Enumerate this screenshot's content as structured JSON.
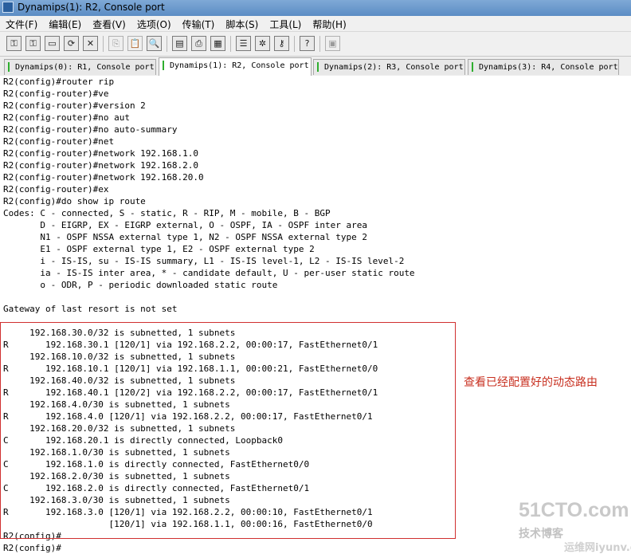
{
  "window": {
    "title": "Dynamips(1): R2, Console port"
  },
  "menu": [
    "文件(F)",
    "编辑(E)",
    "查看(V)",
    "选项(O)",
    "传输(T)",
    "脚本(S)",
    "工具(L)",
    "帮助(H)"
  ],
  "toolbar": {
    "icons": [
      "connect-icon",
      "quick-connect-icon",
      "connect-tab-icon",
      "reconnect-icon",
      "disconnect-icon",
      "copy-icon",
      "paste-icon",
      "find-icon",
      "print-setup-icon",
      "print-icon",
      "print-screen-icon",
      "session-options-icon",
      "global-options-icon",
      "keymap-icon",
      "help-icon",
      "sftp-icon"
    ],
    "glyphs": [
      "⚿",
      "⚿",
      "▭",
      "⟳",
      "✕",
      "⎘",
      "📋",
      "🔍",
      "▤",
      "⎙",
      "▦",
      "☰",
      "✲",
      "⚷",
      "?",
      "▣"
    ]
  },
  "tabs": [
    {
      "label": "Dynamips(0): R1, Console port",
      "active": false
    },
    {
      "label": "Dynamips(1): R2, Console port",
      "active": true
    },
    {
      "label": "Dynamips(2): R3, Console port",
      "active": false
    },
    {
      "label": "Dynamips(3): R4, Console port",
      "active": false
    }
  ],
  "terminal": {
    "lines": [
      "R2(config)#router rip",
      "R2(config-router)#ve",
      "R2(config-router)#version 2",
      "R2(config-router)#no aut",
      "R2(config-router)#no auto-summary",
      "R2(config-router)#net",
      "R2(config-router)#network 192.168.1.0",
      "R2(config-router)#network 192.168.2.0",
      "R2(config-router)#network 192.168.20.0",
      "R2(config-router)#ex",
      "R2(config)#do show ip route",
      "Codes: C - connected, S - static, R - RIP, M - mobile, B - BGP",
      "       D - EIGRP, EX - EIGRP external, O - OSPF, IA - OSPF inter area",
      "       N1 - OSPF NSSA external type 1, N2 - OSPF NSSA external type 2",
      "       E1 - OSPF external type 1, E2 - OSPF external type 2",
      "       i - IS-IS, su - IS-IS summary, L1 - IS-IS level-1, L2 - IS-IS level-2",
      "       ia - IS-IS inter area, * - candidate default, U - per-user static route",
      "       o - ODR, P - periodic downloaded static route",
      "",
      "Gateway of last resort is not set",
      "",
      "     192.168.30.0/32 is subnetted, 1 subnets",
      "R       192.168.30.1 [120/1] via 192.168.2.2, 00:00:17, FastEthernet0/1",
      "     192.168.10.0/32 is subnetted, 1 subnets",
      "R       192.168.10.1 [120/1] via 192.168.1.1, 00:00:21, FastEthernet0/0",
      "     192.168.40.0/32 is subnetted, 1 subnets",
      "R       192.168.40.1 [120/2] via 192.168.2.2, 00:00:17, FastEthernet0/1",
      "     192.168.4.0/30 is subnetted, 1 subnets",
      "R       192.168.4.0 [120/1] via 192.168.2.2, 00:00:17, FastEthernet0/1",
      "     192.168.20.0/32 is subnetted, 1 subnets",
      "C       192.168.20.1 is directly connected, Loopback0",
      "     192.168.1.0/30 is subnetted, 1 subnets",
      "C       192.168.1.0 is directly connected, FastEthernet0/0",
      "     192.168.2.0/30 is subnetted, 1 subnets",
      "C       192.168.2.0 is directly connected, FastEthernet0/1",
      "     192.168.3.0/30 is subnetted, 1 subnets",
      "R       192.168.3.0 [120/1] via 192.168.2.2, 00:00:10, FastEthernet0/1",
      "                    [120/1] via 192.168.1.1, 00:00:16, FastEthernet0/0",
      "R2(config)#",
      "R2(config)#"
    ]
  },
  "annotation": {
    "text": "查看已经配置好的动态路由",
    "color": "#c83020"
  },
  "watermark": {
    "site": "51CTO.com",
    "tagline": "技术博客",
    "brand": "运维网",
    "url": "iyunv.com"
  }
}
